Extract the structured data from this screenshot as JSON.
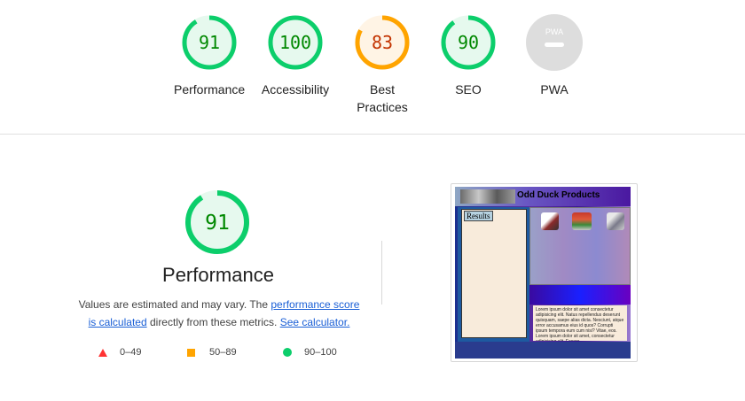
{
  "categories": [
    {
      "id": "performance",
      "score": "91",
      "label": "Performance",
      "status": "pass"
    },
    {
      "id": "accessibility",
      "score": "100",
      "label": "Accessibility",
      "status": "pass"
    },
    {
      "id": "best-practices",
      "score": "83",
      "label_line1": "Best",
      "label_line2": "Practices",
      "status": "average"
    },
    {
      "id": "seo",
      "score": "90",
      "label": "SEO",
      "status": "pass"
    },
    {
      "id": "pwa",
      "badge": "PWA",
      "label": "PWA",
      "status": "na"
    }
  ],
  "detail": {
    "score": "91",
    "title": "Performance",
    "desc_prefix": "Values are estimated and may vary. The ",
    "desc_link1": "performance score is calculated",
    "desc_middle": " directly from these metrics. ",
    "desc_link2": "See calculator."
  },
  "legend": {
    "fail": "0–49",
    "average": "50–89",
    "pass": "90–100"
  },
  "screenshot": {
    "title": "Odd Duck Products",
    "results_label": "Results",
    "body_text": "Lorem ipsum dolor sit amet consectetur adipisicing elit. Natus repellendus deserunt quisquam, saepe alias dicta. Nesciunt, atque error accusamus eius id quos? Corrupti ipsum tempora eum cum nisi? Vitae, eos. Lorem ipsum dolor sit amet, consectetur adipisicing elit. Facere"
  },
  "colors": {
    "pass": "#0cce6b",
    "pass_text": "#008800",
    "pass_bg": "#e6f9ee",
    "average": "#ffa400",
    "average_text": "#c33300",
    "average_bg": "#fff4e5",
    "fail": "#ff3333",
    "na": "#dddddd"
  }
}
